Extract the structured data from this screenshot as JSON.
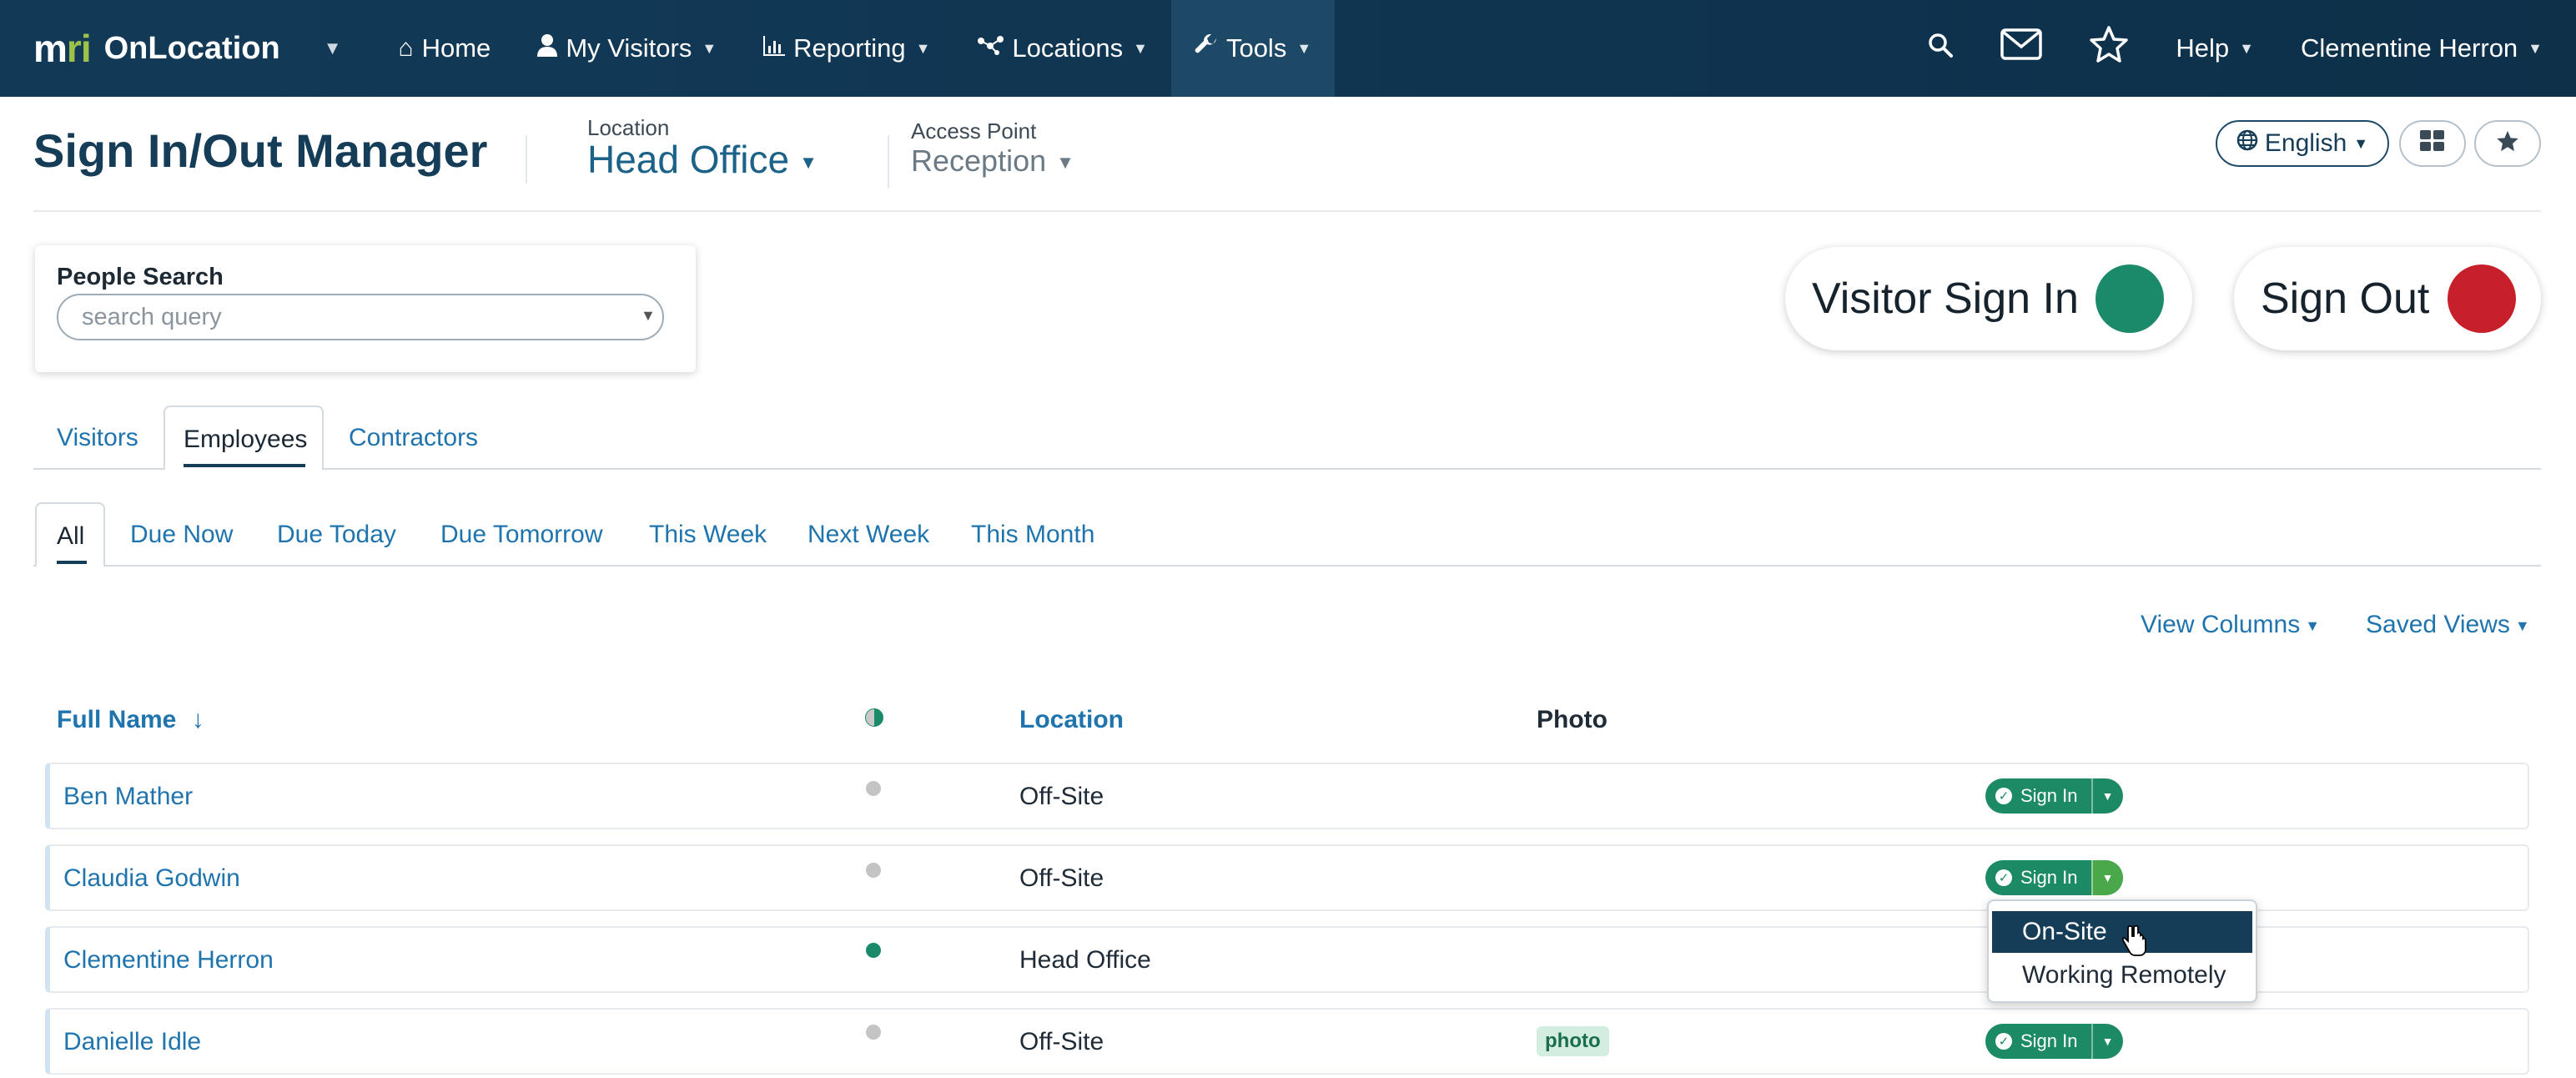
{
  "navbar": {
    "brand_mark_m": "m",
    "brand_mark_r": "r",
    "brand_mark_i": "i",
    "brand_name": "OnLocation",
    "items": [
      {
        "label": "Home",
        "icon": "home-icon"
      },
      {
        "label": "My Visitors",
        "icon": "user-icon"
      },
      {
        "label": "Reporting",
        "icon": "bar-chart-icon"
      },
      {
        "label": "Locations",
        "icon": "network-icon"
      },
      {
        "label": "Tools",
        "icon": "wrench-icon"
      }
    ],
    "help_label": "Help",
    "user_name": "Clementine Herron"
  },
  "header": {
    "title": "Sign In/Out Manager",
    "location_label": "Location",
    "location_value": "Head Office",
    "access_point_label": "Access Point",
    "access_point_value": "Reception",
    "language": "English"
  },
  "search": {
    "label": "People Search",
    "placeholder": "search query"
  },
  "actions": {
    "visitor_sign_in": "Visitor Sign In",
    "sign_out": "Sign Out",
    "sign_in_color": "#1a8a6b",
    "sign_out_color": "#c8202a"
  },
  "tabs": [
    "Visitors",
    "Employees",
    "Contractors"
  ],
  "filters": [
    "All",
    "Due Now",
    "Due Today",
    "Due Tomorrow",
    "This Week",
    "Next Week",
    "This Month"
  ],
  "toolbar": {
    "view_columns": "View Columns",
    "saved_views": "Saved Views"
  },
  "table": {
    "columns": {
      "full_name": "Full Name",
      "sort_arrow": "↓",
      "location": "Location",
      "photo": "Photo"
    },
    "rows": [
      {
        "name": "Ben Mather",
        "status": "off",
        "location": "Off-Site",
        "photo": ""
      },
      {
        "name": "Claudia Godwin",
        "status": "off",
        "location": "Off-Site",
        "photo": ""
      },
      {
        "name": "Clementine Herron",
        "status": "on",
        "location": "Head Office",
        "photo": ""
      },
      {
        "name": "Danielle Idle",
        "status": "off",
        "location": "Off-Site",
        "photo": "photo"
      }
    ],
    "sign_in_label": "Sign In"
  },
  "dropdown": {
    "items": [
      "On-Site",
      "Working Remotely"
    ]
  }
}
